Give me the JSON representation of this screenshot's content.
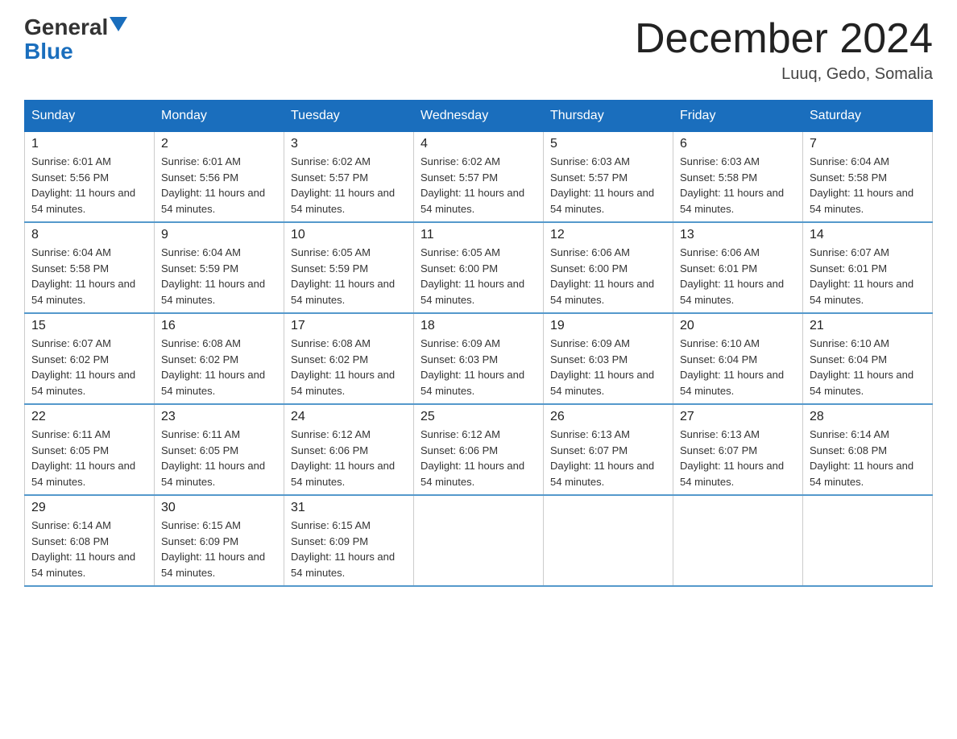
{
  "header": {
    "logo_general": "General",
    "logo_blue": "Blue",
    "month_title": "December 2024",
    "location": "Luuq, Gedo, Somalia"
  },
  "weekdays": [
    "Sunday",
    "Monday",
    "Tuesday",
    "Wednesday",
    "Thursday",
    "Friday",
    "Saturday"
  ],
  "weeks": [
    [
      {
        "day": "1",
        "sunrise": "6:01 AM",
        "sunset": "5:56 PM",
        "daylight": "11 hours and 54 minutes."
      },
      {
        "day": "2",
        "sunrise": "6:01 AM",
        "sunset": "5:56 PM",
        "daylight": "11 hours and 54 minutes."
      },
      {
        "day": "3",
        "sunrise": "6:02 AM",
        "sunset": "5:57 PM",
        "daylight": "11 hours and 54 minutes."
      },
      {
        "day": "4",
        "sunrise": "6:02 AM",
        "sunset": "5:57 PM",
        "daylight": "11 hours and 54 minutes."
      },
      {
        "day": "5",
        "sunrise": "6:03 AM",
        "sunset": "5:57 PM",
        "daylight": "11 hours and 54 minutes."
      },
      {
        "day": "6",
        "sunrise": "6:03 AM",
        "sunset": "5:58 PM",
        "daylight": "11 hours and 54 minutes."
      },
      {
        "day": "7",
        "sunrise": "6:04 AM",
        "sunset": "5:58 PM",
        "daylight": "11 hours and 54 minutes."
      }
    ],
    [
      {
        "day": "8",
        "sunrise": "6:04 AM",
        "sunset": "5:58 PM",
        "daylight": "11 hours and 54 minutes."
      },
      {
        "day": "9",
        "sunrise": "6:04 AM",
        "sunset": "5:59 PM",
        "daylight": "11 hours and 54 minutes."
      },
      {
        "day": "10",
        "sunrise": "6:05 AM",
        "sunset": "5:59 PM",
        "daylight": "11 hours and 54 minutes."
      },
      {
        "day": "11",
        "sunrise": "6:05 AM",
        "sunset": "6:00 PM",
        "daylight": "11 hours and 54 minutes."
      },
      {
        "day": "12",
        "sunrise": "6:06 AM",
        "sunset": "6:00 PM",
        "daylight": "11 hours and 54 minutes."
      },
      {
        "day": "13",
        "sunrise": "6:06 AM",
        "sunset": "6:01 PM",
        "daylight": "11 hours and 54 minutes."
      },
      {
        "day": "14",
        "sunrise": "6:07 AM",
        "sunset": "6:01 PM",
        "daylight": "11 hours and 54 minutes."
      }
    ],
    [
      {
        "day": "15",
        "sunrise": "6:07 AM",
        "sunset": "6:02 PM",
        "daylight": "11 hours and 54 minutes."
      },
      {
        "day": "16",
        "sunrise": "6:08 AM",
        "sunset": "6:02 PM",
        "daylight": "11 hours and 54 minutes."
      },
      {
        "day": "17",
        "sunrise": "6:08 AM",
        "sunset": "6:02 PM",
        "daylight": "11 hours and 54 minutes."
      },
      {
        "day": "18",
        "sunrise": "6:09 AM",
        "sunset": "6:03 PM",
        "daylight": "11 hours and 54 minutes."
      },
      {
        "day": "19",
        "sunrise": "6:09 AM",
        "sunset": "6:03 PM",
        "daylight": "11 hours and 54 minutes."
      },
      {
        "day": "20",
        "sunrise": "6:10 AM",
        "sunset": "6:04 PM",
        "daylight": "11 hours and 54 minutes."
      },
      {
        "day": "21",
        "sunrise": "6:10 AM",
        "sunset": "6:04 PM",
        "daylight": "11 hours and 54 minutes."
      }
    ],
    [
      {
        "day": "22",
        "sunrise": "6:11 AM",
        "sunset": "6:05 PM",
        "daylight": "11 hours and 54 minutes."
      },
      {
        "day": "23",
        "sunrise": "6:11 AM",
        "sunset": "6:05 PM",
        "daylight": "11 hours and 54 minutes."
      },
      {
        "day": "24",
        "sunrise": "6:12 AM",
        "sunset": "6:06 PM",
        "daylight": "11 hours and 54 minutes."
      },
      {
        "day": "25",
        "sunrise": "6:12 AM",
        "sunset": "6:06 PM",
        "daylight": "11 hours and 54 minutes."
      },
      {
        "day": "26",
        "sunrise": "6:13 AM",
        "sunset": "6:07 PM",
        "daylight": "11 hours and 54 minutes."
      },
      {
        "day": "27",
        "sunrise": "6:13 AM",
        "sunset": "6:07 PM",
        "daylight": "11 hours and 54 minutes."
      },
      {
        "day": "28",
        "sunrise": "6:14 AM",
        "sunset": "6:08 PM",
        "daylight": "11 hours and 54 minutes."
      }
    ],
    [
      {
        "day": "29",
        "sunrise": "6:14 AM",
        "sunset": "6:08 PM",
        "daylight": "11 hours and 54 minutes."
      },
      {
        "day": "30",
        "sunrise": "6:15 AM",
        "sunset": "6:09 PM",
        "daylight": "11 hours and 54 minutes."
      },
      {
        "day": "31",
        "sunrise": "6:15 AM",
        "sunset": "6:09 PM",
        "daylight": "11 hours and 54 minutes."
      },
      null,
      null,
      null,
      null
    ]
  ]
}
